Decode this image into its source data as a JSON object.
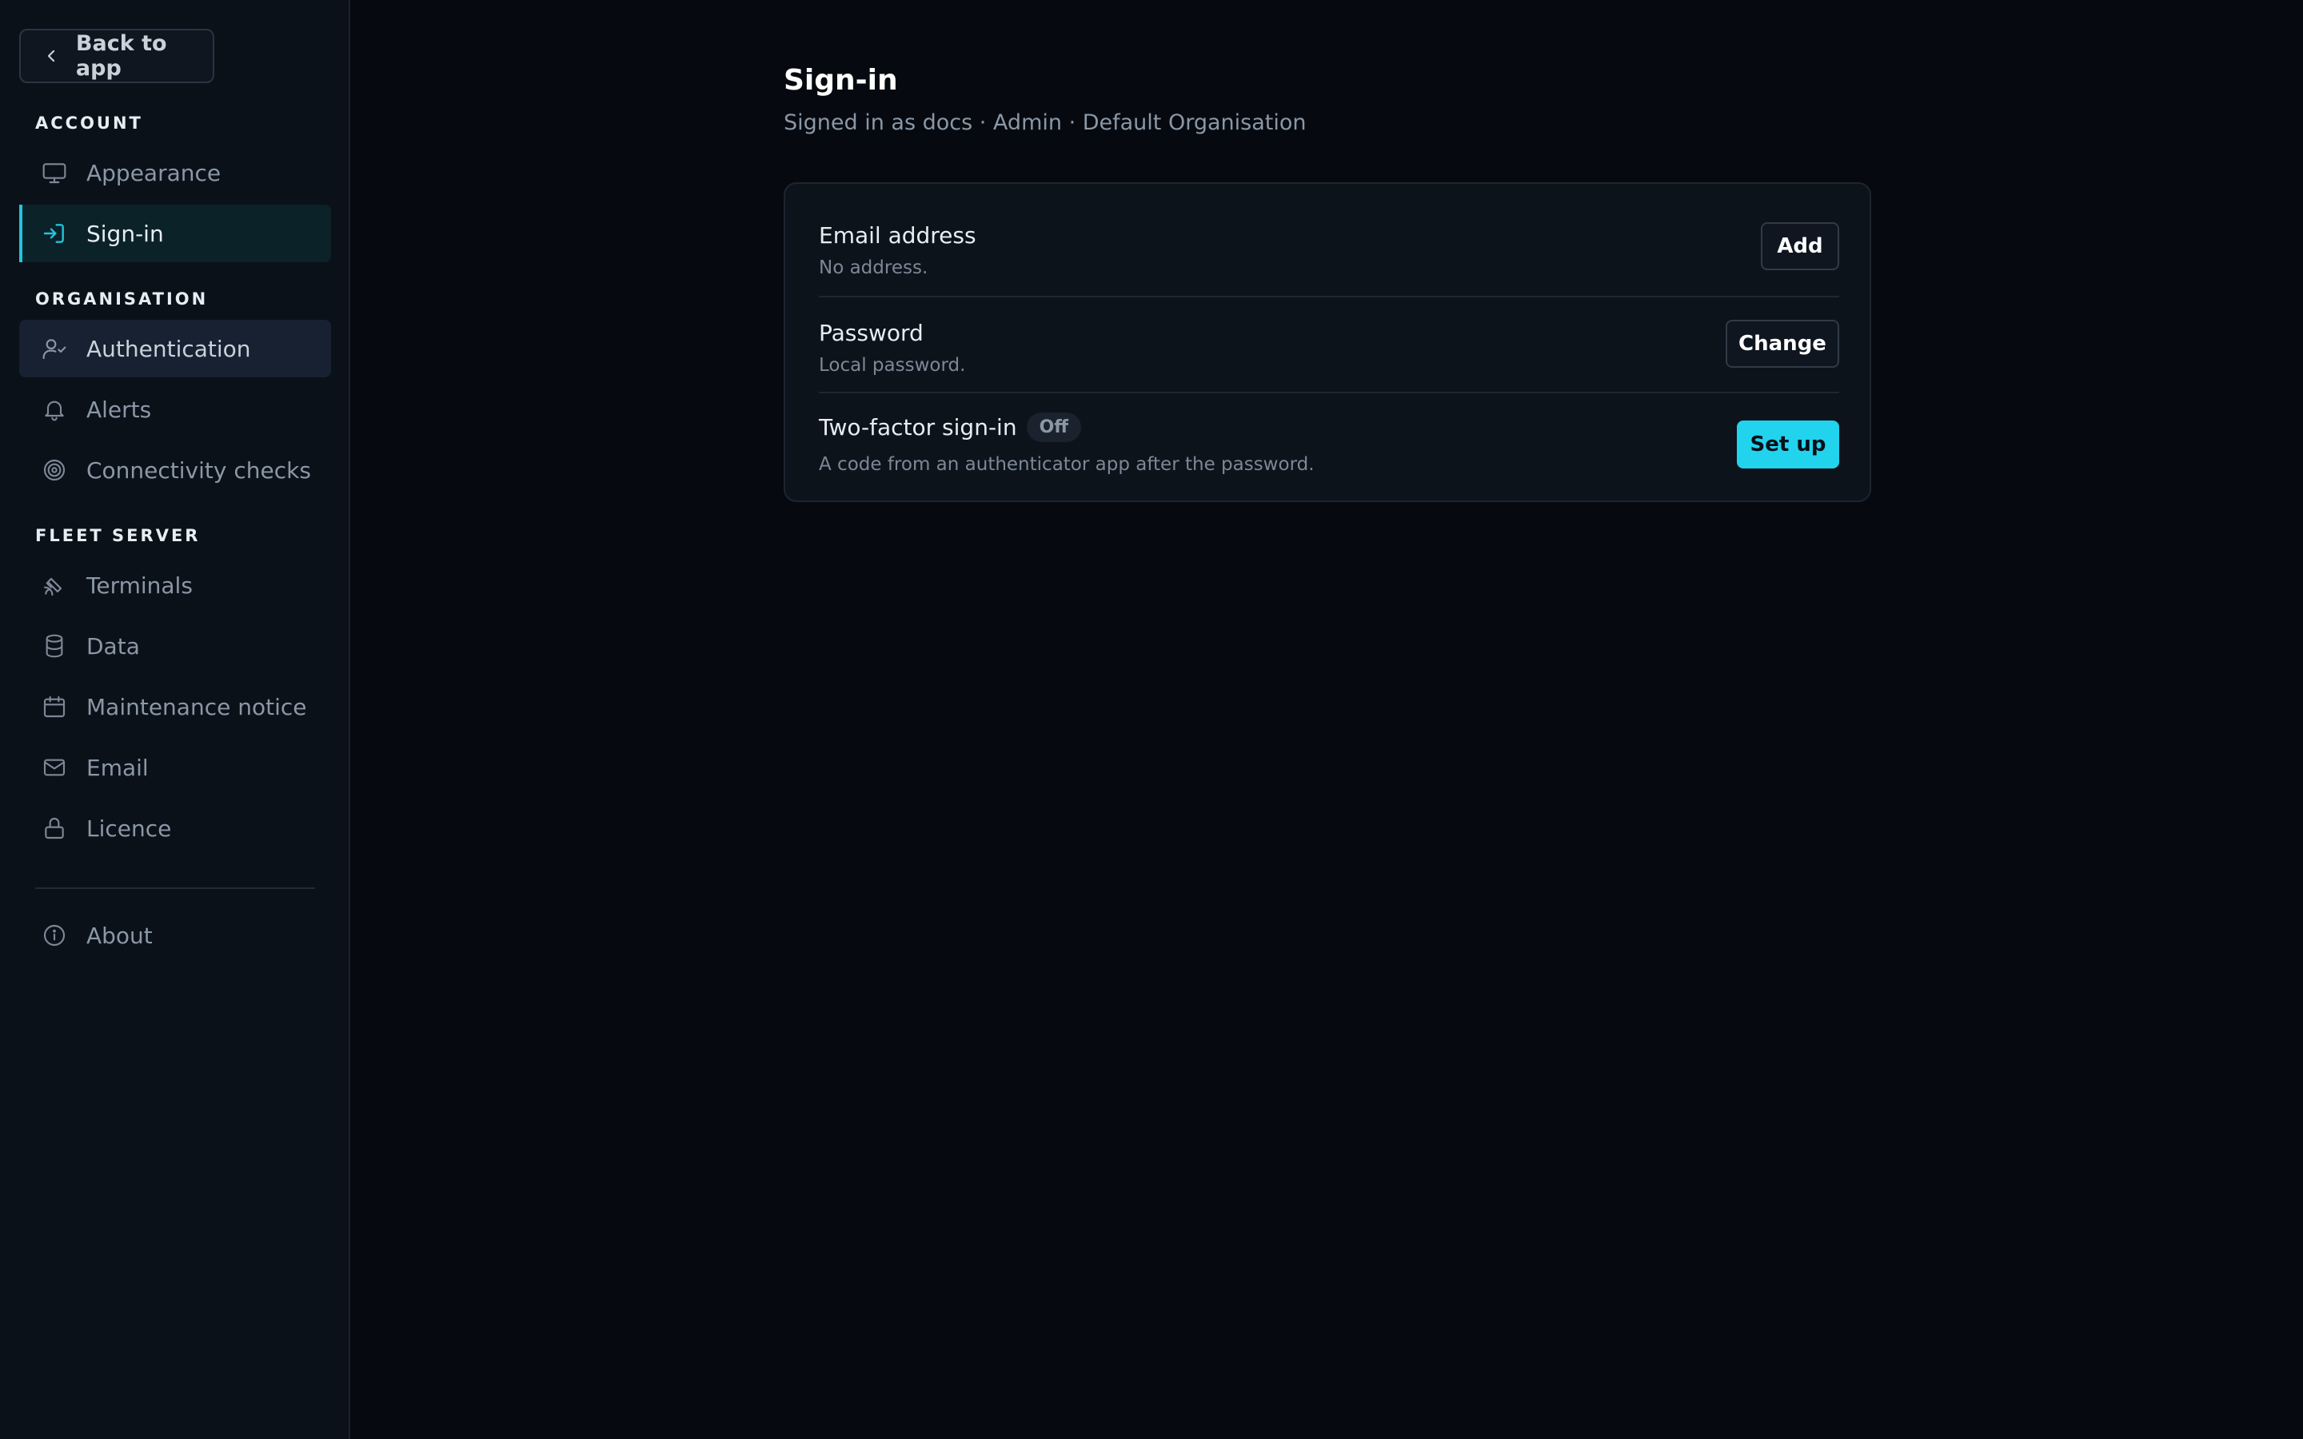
{
  "sidebar": {
    "back_label": "Back to app",
    "sections": {
      "account": "ACCOUNT",
      "organisation": "ORGANISATION",
      "fleet_server": "FLEET SERVER"
    },
    "items": {
      "appearance": "Appearance",
      "sign_in": "Sign-in",
      "authentication": "Authentication",
      "alerts": "Alerts",
      "connectivity": "Connectivity checks",
      "terminals": "Terminals",
      "data": "Data",
      "maintenance": "Maintenance notice",
      "email": "Email",
      "licence": "Licence",
      "about": "About"
    },
    "active_item": "sign_in",
    "hover_item": "authentication"
  },
  "main": {
    "title": "Sign-in",
    "subtitle": "Signed in as docs · Admin · Default Organisation",
    "rows": {
      "email": {
        "title": "Email address",
        "desc": "No address.",
        "button": "Add"
      },
      "password": {
        "title": "Password",
        "desc": "Local password.",
        "button": "Change"
      },
      "two_factor": {
        "title": "Two-factor sign-in",
        "badge": "Off",
        "desc": "A code from an authenticator app after the password.",
        "button": "Set up"
      }
    }
  },
  "colors": {
    "accent": "#22d3ee",
    "background": "#060a10",
    "sidebar": "#0b1119"
  }
}
